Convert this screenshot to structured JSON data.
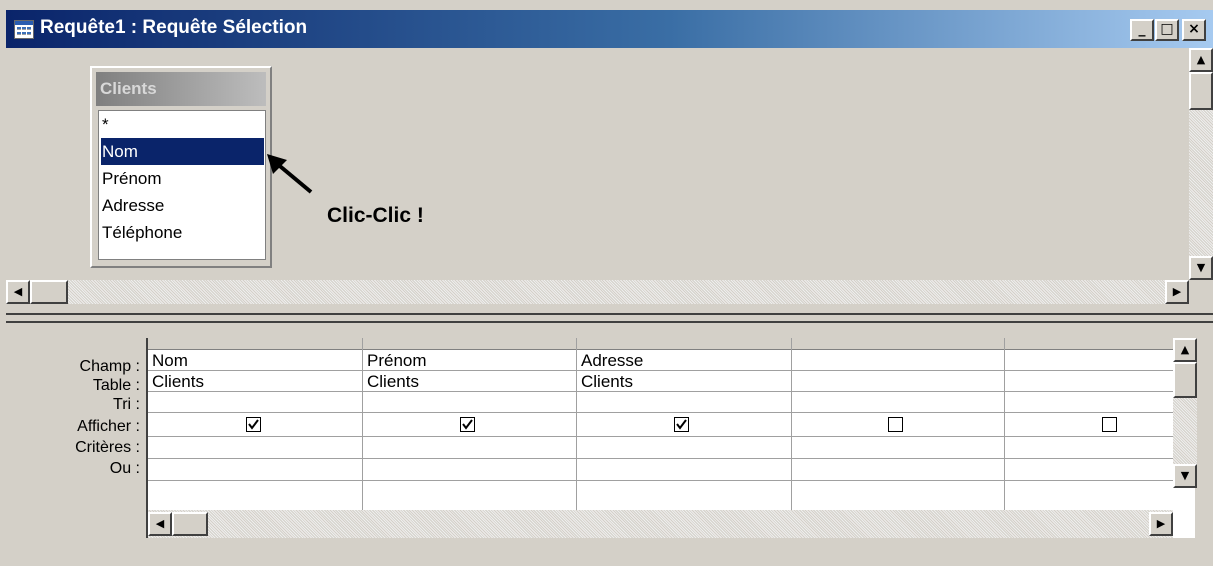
{
  "window": {
    "title": "Requête1 : Requête Sélection",
    "minimize": "_",
    "maximize": "□",
    "close": "×"
  },
  "table_box": {
    "title": "Clients",
    "fields": [
      "*",
      "Nom",
      "Prénom",
      "Adresse",
      "Téléphone"
    ],
    "selected_index": 1
  },
  "annotation": "Clic-Clic !",
  "grid": {
    "row_labels": [
      "Champ :",
      "Table :",
      "Tri :",
      "Afficher :",
      "Critères :",
      "Ou :"
    ],
    "columns": [
      {
        "champ": "Nom",
        "table": "Clients",
        "afficher": true
      },
      {
        "champ": "Prénom",
        "table": "Clients",
        "afficher": true
      },
      {
        "champ": "Adresse",
        "table": "Clients",
        "afficher": true
      },
      {
        "champ": "",
        "table": "",
        "afficher": false
      },
      {
        "champ": "",
        "table": "",
        "afficher": false
      }
    ]
  },
  "scroll_icons": {
    "up": "▲",
    "down": "▼",
    "left": "◀",
    "right": "▶"
  }
}
